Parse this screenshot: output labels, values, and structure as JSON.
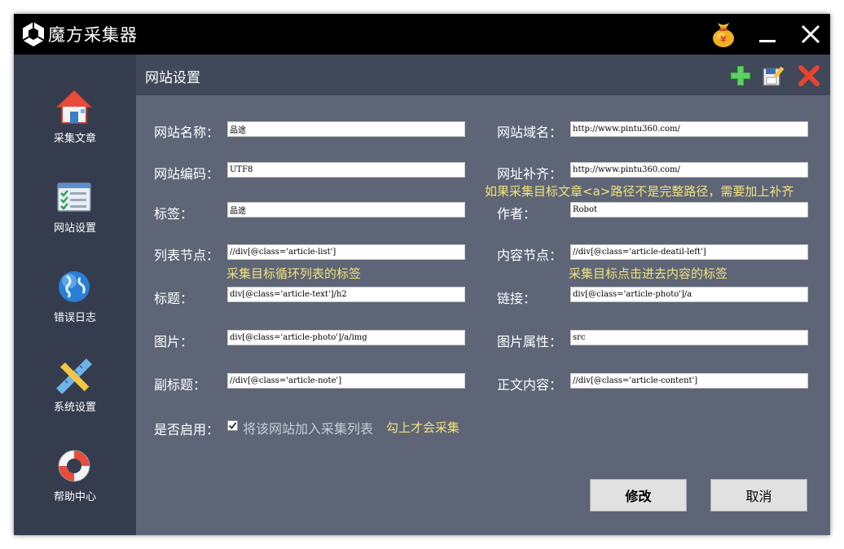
{
  "app": {
    "title": "魔方采集器"
  },
  "titlebar": {
    "icons": [
      "cube-logo-icon",
      "money-bag-icon",
      "minimize-icon",
      "close-icon"
    ]
  },
  "sidebar": {
    "items": [
      {
        "label": "采集文章",
        "icon": "home-icon"
      },
      {
        "label": "网站设置",
        "icon": "checklist-icon"
      },
      {
        "label": "错误日志",
        "icon": "globe-icon"
      },
      {
        "label": "系统设置",
        "icon": "ruler-pencil-icon"
      },
      {
        "label": "帮助中心",
        "icon": "lifebuoy-icon"
      }
    ]
  },
  "header": {
    "title": "网站设置",
    "actions": [
      "add-icon",
      "edit-icon",
      "delete-icon"
    ]
  },
  "form": {
    "site_name": {
      "label": "网站名称：",
      "value": "品途"
    },
    "site_domain": {
      "label": "网站域名：",
      "value": "http://www.pintu360.com/"
    },
    "site_encoding": {
      "label": "网站编码：",
      "value": "UTF8"
    },
    "url_prefix": {
      "label": "网址补齐：",
      "value": "http://www.pintu360.com/"
    },
    "tag": {
      "label": "标签：",
      "value": "品途"
    },
    "author": {
      "label": "作者：",
      "value": "Robot"
    },
    "list_node": {
      "label": "列表节点：",
      "value": "//div[@class='article-list']"
    },
    "content_node": {
      "label": "内容节点：",
      "value": "//div[@class='article-deatil-left']"
    },
    "title": {
      "label": "标题：",
      "value": "div[@class='article-text']/h2"
    },
    "link": {
      "label": "链接：",
      "value": "div[@class='article-photo']/a"
    },
    "image": {
      "label": "图片：",
      "value": "div[@class='article-photo']/a/img"
    },
    "image_attr": {
      "label": "图片属性：",
      "value": "src"
    },
    "subtitle": {
      "label": "副标题：",
      "value": "//div[@class='article-note']"
    },
    "body_content": {
      "label": "正文内容：",
      "value": "//div[@class='article-content']"
    },
    "enabled": {
      "label": "是否启用：",
      "checkbox_label": "将该网站加入采集列表",
      "checked": true
    }
  },
  "hints": {
    "url_prefix": "如果采集目标文章<a>路径不是完整路径，需要加上补齐",
    "list_node": "采集目标循环列表的标签",
    "content_node": "采集目标点击进去内容的标签",
    "enabled": "勾上才会采集"
  },
  "buttons": {
    "modify": "修改",
    "cancel": "取消"
  },
  "colors": {
    "titlebar": "#000000",
    "sidebar": "#353c4e",
    "header": "#404859",
    "content": "#5d6577",
    "hint": "#f2e27a"
  }
}
